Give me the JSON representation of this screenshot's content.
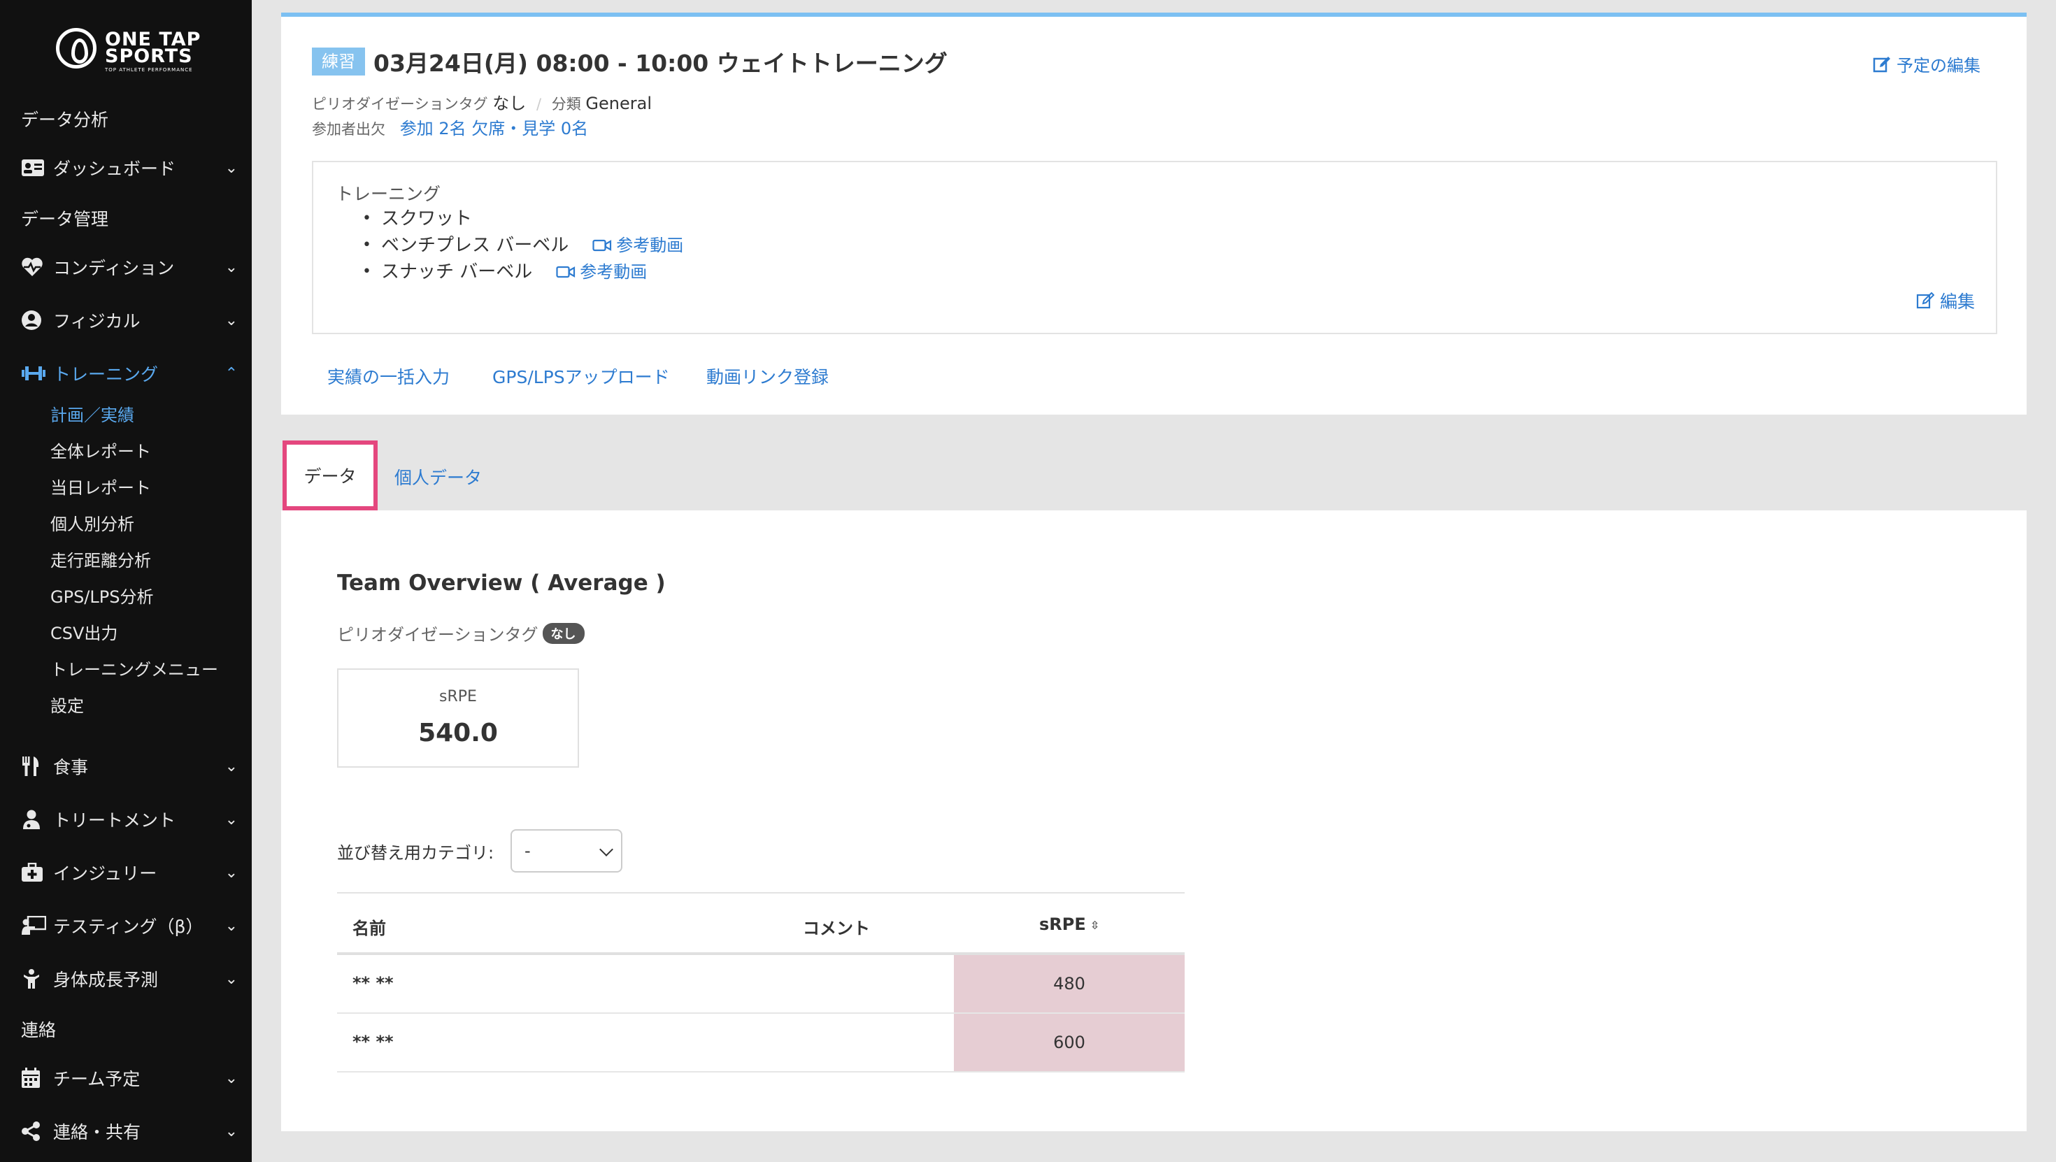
{
  "sidebar": {
    "logo": {
      "line1": "ONE TAP",
      "line2": "SPORTS",
      "tagline": "TOP ATHLETE PERFORMANCE"
    },
    "sections": {
      "data_analysis": "データ分析",
      "data_management": "データ管理",
      "contact": "連絡"
    },
    "items": {
      "dashboard": "ダッシュボード",
      "condition": "コンディション",
      "physical": "フィジカル",
      "training": "トレーニング",
      "meal": "食事",
      "treatment": "トリートメント",
      "injury": "インジュリー",
      "testing": "テスティング（β）",
      "growth": "身体成長予測",
      "team_schedule": "チーム予定",
      "share": "連絡・共有"
    },
    "training_sub": {
      "plan_actual": "計画／実績",
      "overall_report": "全体レポート",
      "daily_report": "当日レポート",
      "individual_analysis": "個人別分析",
      "distance_analysis": "走行距離分析",
      "gps_analysis": "GPS/LPS分析",
      "csv_output": "CSV出力",
      "training_menu": "トレーニングメニュー",
      "settings": "設定"
    },
    "accent_color": "#5aa9ef"
  },
  "event": {
    "badge": "練習",
    "title": "03月24日(月) 08:00 - 10:00 ウェイトトレーニング",
    "edit_plan": "予定の編集",
    "period_tag_label": "ピリオダイゼーションタグ",
    "period_tag_value": "なし",
    "category_label": "分類",
    "category_value": "General",
    "attendance_label": "参加者出欠",
    "attendance_value": "参加 2名 欠席・見学 0名",
    "training_label": "トレーニング",
    "exercises": [
      {
        "name": "スクワット",
        "video": ""
      },
      {
        "name": "ベンチプレス バーベル",
        "video": "参考動画"
      },
      {
        "name": "スナッチ バーベル",
        "video": "参考動画"
      }
    ],
    "edit_training": "編集",
    "actions": {
      "bulk_input": "実績の一括入力",
      "gps_upload": "GPS/LPSアップロード",
      "video_link": "動画リンク登録"
    }
  },
  "tabs": {
    "data": "データ",
    "personal": "個人データ"
  },
  "overview": {
    "title": "Team Overview ( Average )",
    "period_tag_label": "ピリオダイゼーションタグ",
    "period_tag_badge": "なし",
    "srpe_label": "sRPE",
    "srpe_value": "540.0",
    "sort_label": "並び替え用カテゴリ:",
    "sort_value": "-"
  },
  "table": {
    "headers": {
      "name": "名前",
      "comment": "コメント",
      "srpe": "sRPE"
    },
    "rows": [
      {
        "name": "** **",
        "comment": "",
        "srpe": "480"
      },
      {
        "name": "** **",
        "comment": "",
        "srpe": "600"
      }
    ]
  }
}
